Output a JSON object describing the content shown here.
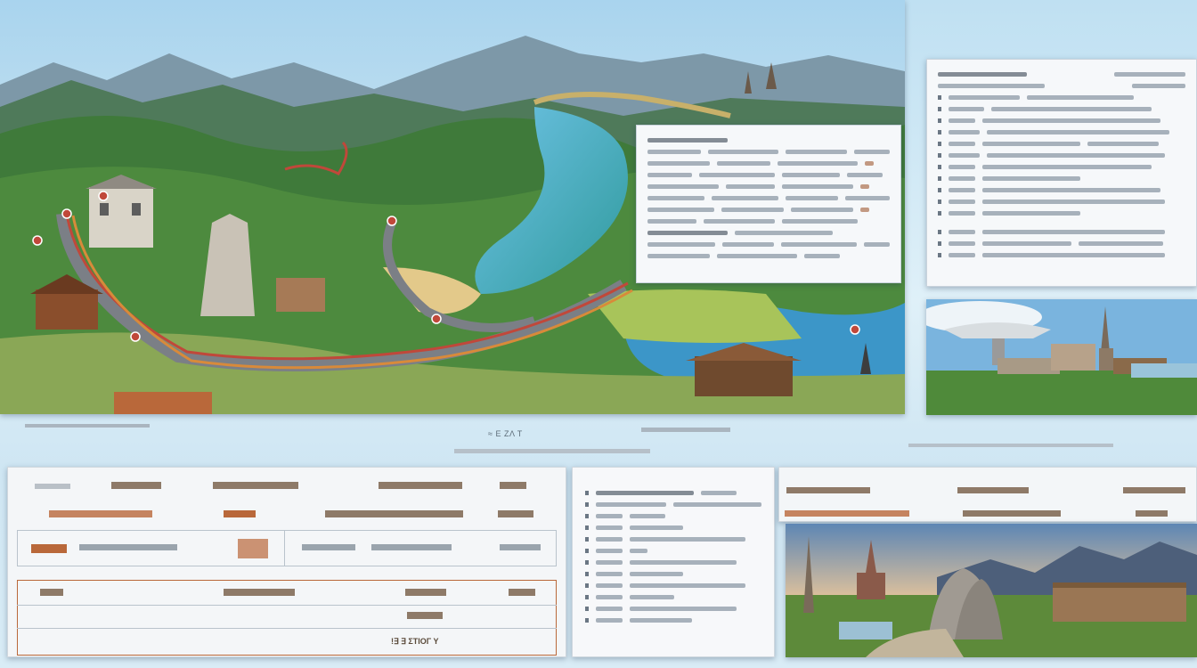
{
  "colors": {
    "sky": "#bfe0f2",
    "route_red": "#c0483a",
    "route_orange": "#d88a3a",
    "water": "#4aa8d8",
    "forest": "#3f7a3a"
  },
  "icons": [
    "map-pin-icon",
    "bullet-icon"
  ],
  "caption": "≈ Ε ΖΛ Τ",
  "table": {
    "footer": "!∃ ∃ ΣΤΙΟΓ Υ"
  }
}
